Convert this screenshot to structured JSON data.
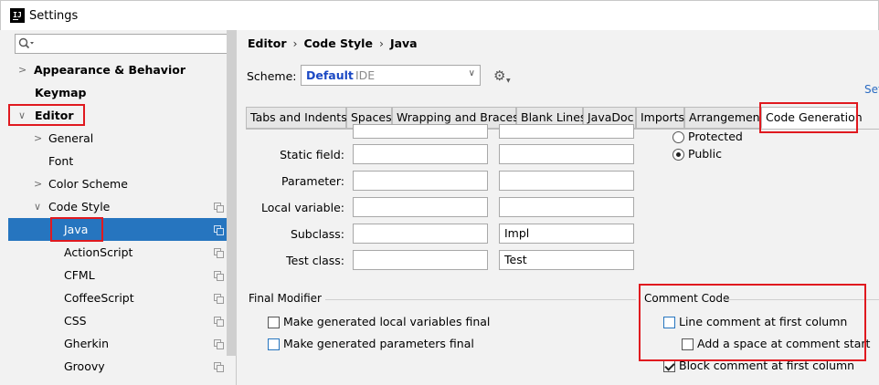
{
  "window": {
    "title": "Settings"
  },
  "search": {
    "placeholder": ""
  },
  "sidebar": {
    "items": [
      {
        "label": "Appearance & Behavior"
      },
      {
        "label": "Keymap"
      },
      {
        "label": "Editor"
      },
      {
        "label": "General"
      },
      {
        "label": "Font"
      },
      {
        "label": "Color Scheme"
      },
      {
        "label": "Code Style"
      },
      {
        "label": "Java"
      },
      {
        "label": "ActionScript"
      },
      {
        "label": "CFML"
      },
      {
        "label": "CoffeeScript"
      },
      {
        "label": "CSS"
      },
      {
        "label": "Gherkin"
      },
      {
        "label": "Groovy"
      }
    ]
  },
  "breadcrumb": {
    "part1": "Editor",
    "part2": "Code Style",
    "part3": "Java",
    "sep": "›"
  },
  "scheme": {
    "label": "Scheme:",
    "value": "Default",
    "sub": "IDE",
    "set_link": "Set"
  },
  "tabs": [
    "Tabs and Indents",
    "Spaces",
    "Wrapping and Braces",
    "Blank Lines",
    "JavaDoc",
    "Imports",
    "Arrangement",
    "Code Generation"
  ],
  "naming": {
    "rows": [
      {
        "label": "Static field:",
        "prefix": "",
        "suffix": ""
      },
      {
        "label": "Parameter:",
        "prefix": "",
        "suffix": ""
      },
      {
        "label": "Local variable:",
        "prefix": "",
        "suffix": ""
      },
      {
        "label": "Subclass:",
        "prefix": "",
        "suffix": "Impl"
      },
      {
        "label": "Test class:",
        "prefix": "",
        "suffix": "Test"
      }
    ]
  },
  "visibility": {
    "protected_label": "Protected",
    "public_label": "Public",
    "selected": "Public"
  },
  "final_modifier": {
    "title": "Final Modifier",
    "local_vars_label": "Make generated local variables final",
    "local_vars_checked": false,
    "params_label": "Make generated parameters final",
    "params_checked": false
  },
  "comment_code": {
    "title": "Comment Code",
    "line_first_col_label": "Line comment at first column",
    "line_first_col_checked": false,
    "add_space_label": "Add a space at comment start",
    "add_space_checked": false,
    "block_first_col_label": "Block comment at first column",
    "block_first_col_checked": true
  },
  "colors": {
    "selection": "#2675bf",
    "highlight_box": "#e0191f",
    "scheme_value": "#1b49c4"
  }
}
